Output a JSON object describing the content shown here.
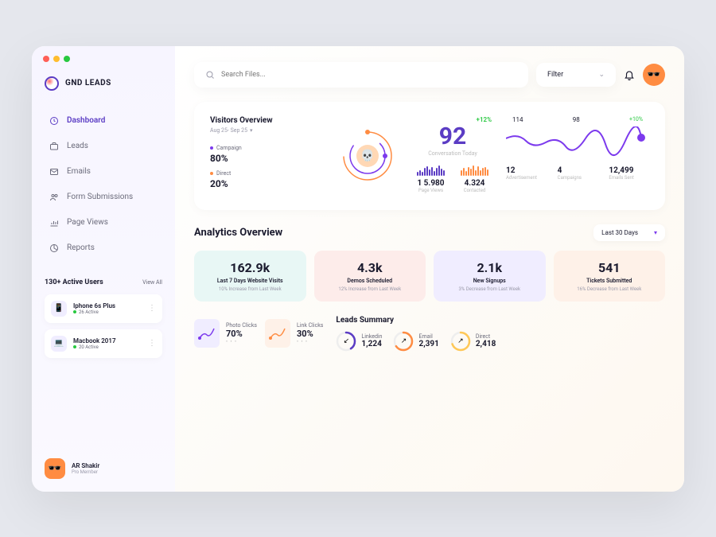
{
  "app": {
    "name": "GND LEADS"
  },
  "nav": {
    "items": [
      {
        "label": "Dashboard",
        "active": true
      },
      {
        "label": "Leads"
      },
      {
        "label": "Emails"
      },
      {
        "label": "Form Submissions"
      },
      {
        "label": "Page Views"
      },
      {
        "label": "Reports"
      }
    ]
  },
  "users": {
    "title": "130+ Active Users",
    "viewAll": "View All",
    "list": [
      {
        "name": "Iphone 6s Plus",
        "stat": "26 Active",
        "icon": "📱"
      },
      {
        "name": "Macbook 2017",
        "stat": "20 Active",
        "icon": "💻"
      }
    ]
  },
  "profile": {
    "name": "AR Shakir",
    "role": "Pro Member"
  },
  "search": {
    "placeholder": "Search Files..."
  },
  "filter": {
    "label": "Filter"
  },
  "overview": {
    "title": "Visitors Overview",
    "date": "Aug 25- Sep 25",
    "legend": {
      "campaign": {
        "label": "Campaign",
        "value": "80%"
      },
      "direct": {
        "label": "Direct",
        "value": "20%"
      }
    },
    "delta": "+12%",
    "bigNum": "92",
    "bigLabel": "Conversation Today",
    "bars": [
      {
        "label": "Page Views",
        "value": "1 5.980"
      },
      {
        "label": "Contacted",
        "value": "4.324"
      }
    ],
    "spark": {
      "left": "114",
      "right": "98",
      "delta": "+10%"
    },
    "mini": [
      {
        "value": "12",
        "label": "Advertisement"
      },
      {
        "value": "4",
        "label": "Campaigns"
      },
      {
        "value": "12,499",
        "label": "Emails Sent"
      }
    ]
  },
  "analytics": {
    "title": "Analytics Overview",
    "range": "Last 30 Days",
    "cards": [
      {
        "value": "162.9k",
        "title": "Last 7 Days Website Visits",
        "sub": "10% Increase from Last Week"
      },
      {
        "value": "4.3k",
        "title": "Demos Scheduled",
        "sub": "12% Increase from Last Week"
      },
      {
        "value": "2.1k",
        "title": "New Signups",
        "sub": "3% Decrease from Last Week"
      },
      {
        "value": "541",
        "title": "Tickets Submitted",
        "sub": "16% Decrease from Last Week"
      }
    ]
  },
  "clicks": [
    {
      "label": "Photo Clicks",
      "value": "70%"
    },
    {
      "label": "Link Clicks",
      "value": "30%"
    }
  ],
  "leads": {
    "title": "Leads Summary",
    "items": [
      {
        "label": "Linkedin",
        "value": "1,224",
        "color": "#5b3cc4",
        "arrow": "↙"
      },
      {
        "label": "Email",
        "value": "2,391",
        "color": "#ff8c42",
        "arrow": "↗"
      },
      {
        "label": "Direct",
        "value": "2,418",
        "color": "#ffc857",
        "arrow": "↗"
      }
    ]
  },
  "chart_data": {
    "visitors_donut": {
      "type": "pie",
      "series": [
        {
          "name": "Campaign",
          "value": 80
        },
        {
          "name": "Direct",
          "value": 20
        }
      ]
    },
    "page_views_bars": {
      "type": "bar",
      "values": [
        4,
        7,
        5,
        9,
        12,
        8,
        11,
        6,
        10,
        13,
        9,
        7
      ],
      "title": "Page Views"
    },
    "contacted_bars": {
      "type": "bar",
      "values": [
        6,
        9,
        5,
        10,
        8,
        12,
        7,
        11,
        6,
        9,
        10,
        8
      ],
      "title": "Contacted"
    },
    "sparkline": {
      "type": "line",
      "x": [
        0,
        1,
        2,
        3,
        4,
        5,
        6,
        7,
        8
      ],
      "y": [
        114,
        108,
        116,
        104,
        110,
        98,
        106,
        100,
        112
      ],
      "ylim": [
        90,
        120
      ]
    },
    "clicks_pie": {
      "type": "pie",
      "series": [
        {
          "name": "Photo Clicks",
          "value": 70
        },
        {
          "name": "Link Clicks",
          "value": 30
        }
      ]
    },
    "leads_rings": [
      {
        "name": "Linkedin",
        "value": 1224,
        "pct": 40
      },
      {
        "name": "Email",
        "value": 2391,
        "pct": 65
      },
      {
        "name": "Direct",
        "value": 2418,
        "pct": 70
      }
    ]
  }
}
